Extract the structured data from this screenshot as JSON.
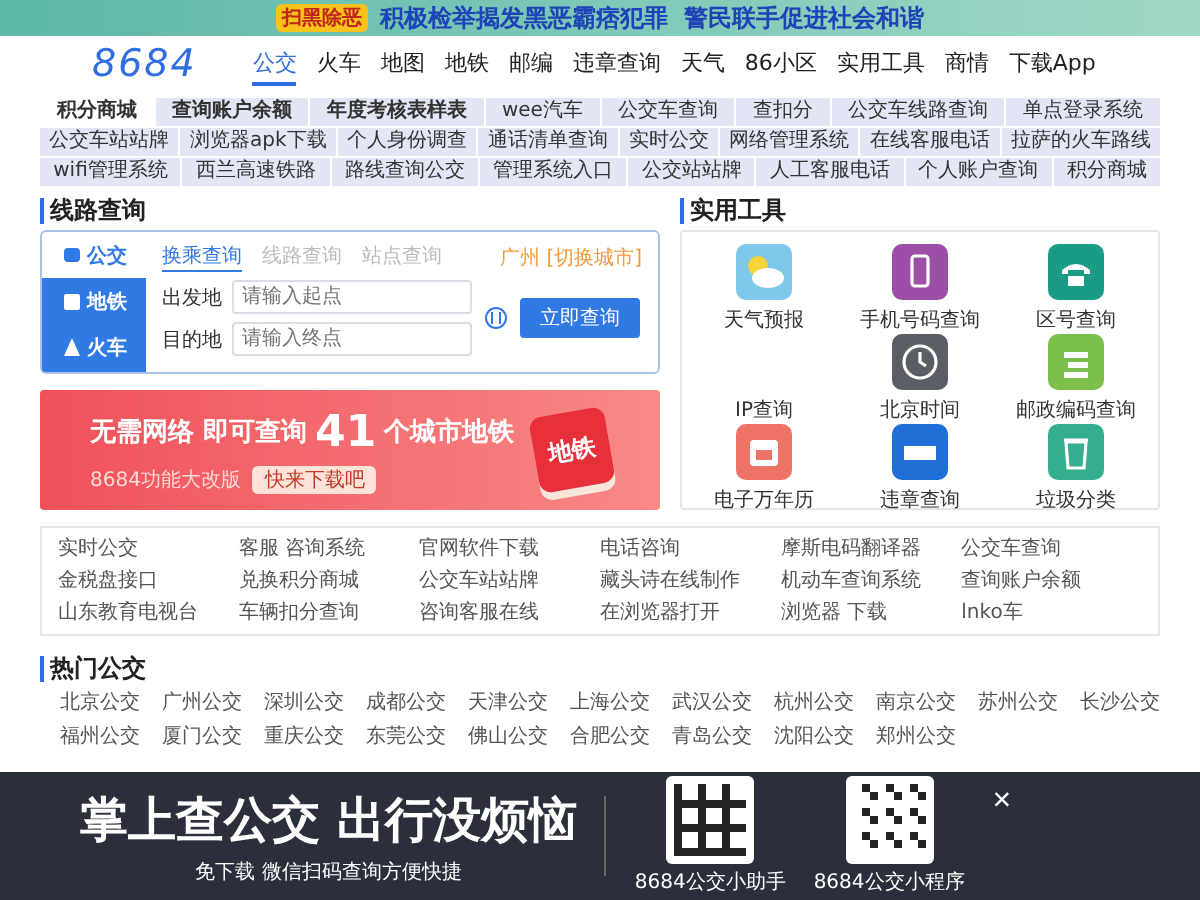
{
  "top_banner": {
    "badge": "扫黑除恶",
    "slogan": "积极检举揭发黑恶霸痞犯罪  警民联手促进社会和谐"
  },
  "header": {
    "logo": "8684",
    "nav": [
      {
        "label": "公交",
        "selected": true
      },
      {
        "label": "火车",
        "selected": false
      },
      {
        "label": "地图",
        "selected": false
      },
      {
        "label": "地铁",
        "selected": false
      },
      {
        "label": "邮编",
        "selected": false
      },
      {
        "label": "违章查询",
        "selected": false
      },
      {
        "label": "天气",
        "selected": false
      },
      {
        "label": "86小区",
        "selected": false
      },
      {
        "label": "实用工具",
        "selected": false
      },
      {
        "label": "商情",
        "selected": false
      },
      {
        "label": "下载App",
        "selected": false
      }
    ]
  },
  "link_grid": [
    [
      {
        "label": "积分商城",
        "selected": true
      },
      {
        "label": "查询账户余额",
        "selected": false
      },
      {
        "label": "年度考核表样表",
        "selected": false
      },
      {
        "label": "wee汽车",
        "selected": false
      },
      {
        "label": "公交车查询",
        "selected": false
      },
      {
        "label": "查扣分",
        "selected": false
      },
      {
        "label": "公交车线路查询",
        "selected": false
      },
      {
        "label": "单点登录系统",
        "selected": false
      }
    ],
    [
      {
        "label": "公交车站站牌",
        "selected": false
      },
      {
        "label": "浏览器apk下载",
        "selected": false
      },
      {
        "label": "个人身份调查",
        "selected": false
      },
      {
        "label": "通话清单查询",
        "selected": false
      },
      {
        "label": "实时公交",
        "selected": false
      },
      {
        "label": "网络管理系统",
        "selected": false
      },
      {
        "label": "在线客服电话",
        "selected": false
      },
      {
        "label": "拉萨的火车路线",
        "selected": false
      }
    ],
    [
      {
        "label": "wifi管理系统",
        "selected": false
      },
      {
        "label": "西兰高速铁路",
        "selected": false
      },
      {
        "label": "路线查询公交",
        "selected": false
      },
      {
        "label": "管理系统入口",
        "selected": false
      },
      {
        "label": "公交站站牌",
        "selected": false
      },
      {
        "label": "人工客服电话",
        "selected": false
      },
      {
        "label": "个人账户查询",
        "selected": false
      },
      {
        "label": "积分商城",
        "selected": false
      }
    ]
  ],
  "route_search": {
    "title": "线路查询",
    "modes": [
      {
        "label": "公交",
        "selected": true
      },
      {
        "label": "地铁",
        "selected": false
      },
      {
        "label": "火车",
        "selected": false
      }
    ],
    "subtabs": [
      {
        "label": "换乘查询",
        "selected": true
      },
      {
        "label": "线路查询",
        "selected": false
      },
      {
        "label": "站点查询",
        "selected": false
      }
    ],
    "city": "广州 [切换城市]",
    "fields": [
      {
        "label": "出发地",
        "placeholder": "请输入起点"
      },
      {
        "label": "目的地",
        "placeholder": "请输入终点"
      }
    ],
    "button": "立即查询"
  },
  "ad": {
    "headline_left": "无需网络 即可查询",
    "number": "41",
    "headline_right": "个城市地铁",
    "note": "8684功能大改版",
    "button": "快来下载吧",
    "app_label": "地铁"
  },
  "tools": {
    "title": "实用工具",
    "items": [
      {
        "label": "天气预报",
        "color": "#7ec8ec"
      },
      {
        "label": "手机号码查询",
        "color": "#9b4fa6"
      },
      {
        "label": "区号查询",
        "color": "#1a9b86"
      },
      {
        "label": "IP查询"
      },
      {
        "label": "北京时间",
        "color": "#5a5d63"
      },
      {
        "label": "邮政编码查询",
        "color": "#7cbf4a"
      },
      {
        "label": "电子万年历",
        "color": "#ef7466"
      },
      {
        "label": "违章查询",
        "color": "#1f6fd6"
      },
      {
        "label": "垃圾分类",
        "color": "#35ad8f"
      }
    ]
  },
  "links": [
    [
      "实时公交",
      "客服 咨询系统",
      "官网软件下载",
      "电话咨询",
      "摩斯电码翻译器",
      "公交车查询"
    ],
    [
      "金税盘接口",
      "兑换积分商城",
      "公交车站站牌",
      "藏头诗在线制作",
      "机动车查询系统",
      "查询账户余额"
    ],
    [
      "山东教育电视台",
      "车辆扣分查询",
      "咨询客服在线",
      "在浏览器打开",
      "浏览器 下载",
      "lnko车"
    ]
  ],
  "hot_bus": {
    "title": "热门公交",
    "rows": [
      [
        "北京公交",
        "广州公交",
        "深圳公交",
        "成都公交",
        "天津公交",
        "上海公交",
        "武汉公交",
        "杭州公交",
        "南京公交",
        "苏州公交",
        "长沙公交"
      ],
      [
        "福州公交",
        "厦门公交",
        "重庆公交",
        "东莞公交",
        "佛山公交",
        "合肥公交",
        "青岛公交",
        "沈阳公交",
        "郑州公交"
      ]
    ]
  },
  "popup": {
    "headline": "掌上查公交 出行没烦恼",
    "subline": "免下载 微信扫码查询方便快捷",
    "codes": [
      "8684公交小助手",
      "8684公交小程序"
    ],
    "close": "×"
  }
}
